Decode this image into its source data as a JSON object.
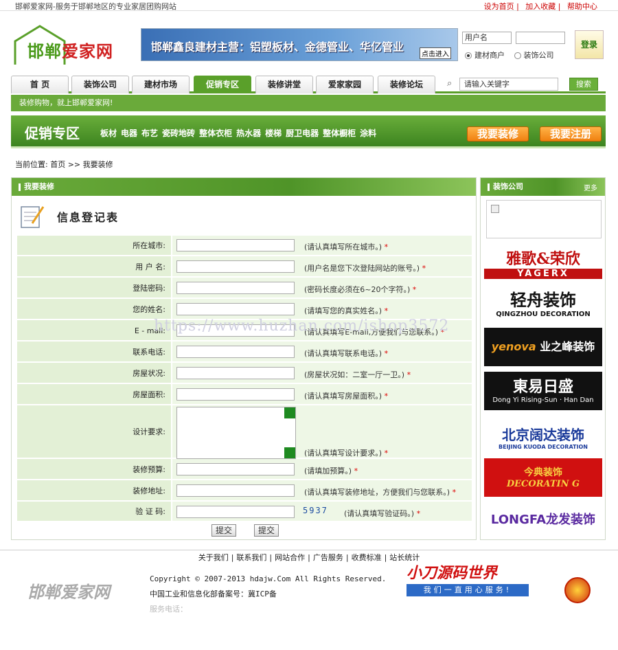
{
  "topbar": {
    "desc": "邯郸爱家网-服务于邯郸地区的专业家居团购网站",
    "links": [
      "设为首页",
      "加入收藏",
      "帮助中心"
    ]
  },
  "logo": {
    "text_a": "邯郸",
    "text_b": "爱家网"
  },
  "banner": {
    "text": "邯郸鑫良建材主营：铝塑板材、金德管业、华亿管业",
    "button": "点击进入"
  },
  "login": {
    "username_placeholder": "用户名",
    "password_placeholder": "",
    "button": "登录",
    "roles": [
      "建材商户",
      "装饰公司"
    ],
    "selected_role": "建材商户"
  },
  "nav": {
    "tabs": [
      "首 页",
      "装饰公司",
      "建材市场",
      "促销专区",
      "装修讲堂",
      "爱家家园",
      "装修论坛"
    ],
    "active": "促销专区"
  },
  "search": {
    "placeholder": "请输入关键字",
    "button": "搜索"
  },
  "subnav": {
    "text": "装修购物，就上邯郸爱家网!"
  },
  "promo": {
    "title": "促销专区",
    "cats": [
      "板材",
      "电器",
      "布艺",
      "瓷砖地砖",
      "整体衣柜",
      "热水器",
      "楼梯",
      "厨卫电器",
      "整体橱柜",
      "涂料"
    ],
    "btn_decorate": "我要装修",
    "btn_register": "我要注册"
  },
  "breadcrumb": {
    "label": "当前位置:",
    "home": "首页",
    "sep": ">>",
    "current": "我要装修"
  },
  "main": {
    "header": "我要装修",
    "form_title": "信息登记表"
  },
  "form": {
    "rows": [
      {
        "label": "所在城市:",
        "hint": "(请认真填写所在城市。)",
        "star": "*"
      },
      {
        "label": "用 户 名:",
        "hint": "(用户名是您下次登陆网站的账号。)",
        "star": "*"
      },
      {
        "label": "登陆密码:",
        "hint": "(密码长度必须在6~20个字符。)",
        "star": "*"
      },
      {
        "label": "您的姓名:",
        "hint": "(请填写您的真实姓名。)",
        "star": "*"
      },
      {
        "label": "E - mail:",
        "hint": "(请认真填写E-mail,方便我们与您联系。)",
        "star": "*"
      },
      {
        "label": "联系电话:",
        "hint": "(请认真填写联系电话。)",
        "star": "*"
      },
      {
        "label": "房屋状况:",
        "hint": "(房屋状况如：二室一厅一卫。)",
        "star": "*"
      },
      {
        "label": "房屋面积:",
        "hint": "(请认真填写房屋面积。)",
        "star": "*"
      },
      {
        "label": "设计要求:",
        "hint": "(请认真填写设计要求。)",
        "star": "*"
      },
      {
        "label": "装修预算:",
        "hint": "(请填加预算。)",
        "star": "*"
      },
      {
        "label": "装修地址:",
        "hint": "(请认真填写装修地址，方便我们与您联系。)",
        "star": "*"
      },
      {
        "label": "验 证 码:",
        "hint": "(请认真填写验证码。)",
        "star": "*"
      }
    ],
    "captcha": "5937",
    "submit": "提交",
    "reset": "提交"
  },
  "sidebar": {
    "header": "装饰公司",
    "more": "更多",
    "brands": [
      {
        "name": "雅歌&荣欣",
        "sub": "YAGERX"
      },
      {
        "name": "轻舟装饰",
        "sub": "QINGZHOU DECORATION"
      },
      {
        "name": "业之峰装饰",
        "sub": "yenova"
      },
      {
        "name": "東易日盛",
        "sub": "Dong Yi Rising-Sun · Han Dan"
      },
      {
        "name": "北京阔达装饰",
        "sub": "BEIJING KUODA DECORATION"
      },
      {
        "name": "今典装饰",
        "sub": "DECORATIN G"
      },
      {
        "name": "LONGFA龙发装饰",
        "sub": ""
      }
    ]
  },
  "footer": {
    "links": [
      "关于我们",
      "联系我们",
      "网站合作",
      "广告服务",
      "收费标准",
      "站长统计"
    ],
    "logo": "邯郸爱家网",
    "copyright": "Copyright © 2007-2013 hdajw.Com All Rights Reserved.",
    "icp": "中国工业和信息化部备案号：冀ICP备",
    "contact": "服务电话："
  },
  "watermark": "https://www.huzhan.com/ishop3572",
  "partner": {
    "name": "小刀源码世界",
    "slogan": "我们一直用心服务!"
  },
  "colors": {
    "green": "#5aa02a",
    "orange": "#f08010",
    "red": "#d00000"
  }
}
